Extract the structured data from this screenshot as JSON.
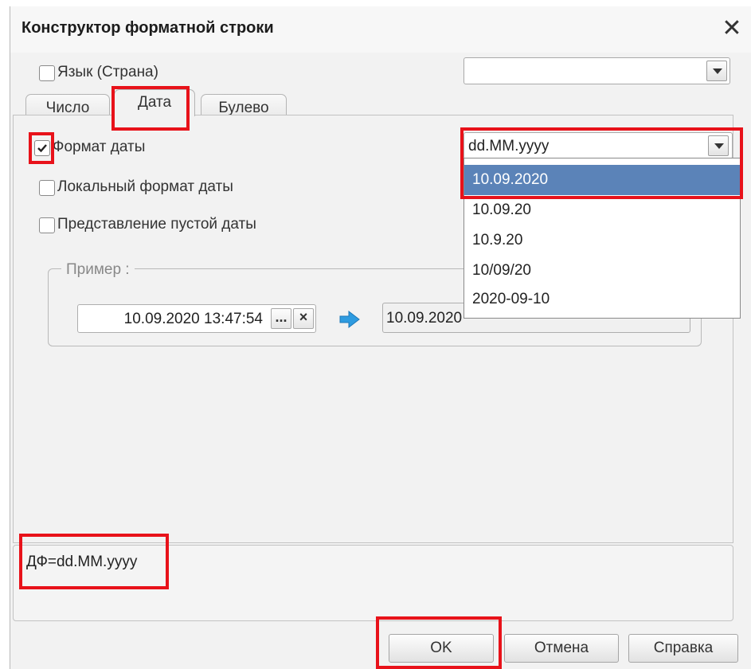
{
  "dialog": {
    "title": "Конструктор форматной строки",
    "close_icon": "close-icon"
  },
  "language": {
    "checkbox_label": "Язык (Страна)",
    "checked": false,
    "select_value": ""
  },
  "tabs": [
    {
      "label": "Число",
      "active": false
    },
    {
      "label": "Дата",
      "active": true
    },
    {
      "label": "Булево",
      "active": false
    }
  ],
  "date_tab": {
    "format_date": {
      "label": "Формат даты",
      "checked": true
    },
    "local_format": {
      "label": "Локальный формат даты",
      "checked": false
    },
    "empty_date": {
      "label": "Представление пустой даты",
      "checked": false
    },
    "format_select": {
      "value": "dd.MM.yyyy",
      "options": [
        "10.09.2020",
        "10.09.20",
        "10.9.20",
        "10/09/20",
        "2020-09-10"
      ],
      "highlighted_option": "10.09.2020"
    },
    "example": {
      "group_label": "Пример :",
      "input_value": "10.09.2020 13:47:54",
      "ellipsis_label": "...",
      "clear_label": "×",
      "result_value": "10.09.2020"
    }
  },
  "format_string": "ДФ=dd.MM.yyyy",
  "buttons": {
    "ok": "OK",
    "cancel": "Отмена",
    "help": "Справка"
  },
  "colors": {
    "highlight": "#e8121a",
    "selected_option_bg": "#5b83b8",
    "arrow": "#2e9be0",
    "dialog_bg": "#f2f2f2"
  }
}
